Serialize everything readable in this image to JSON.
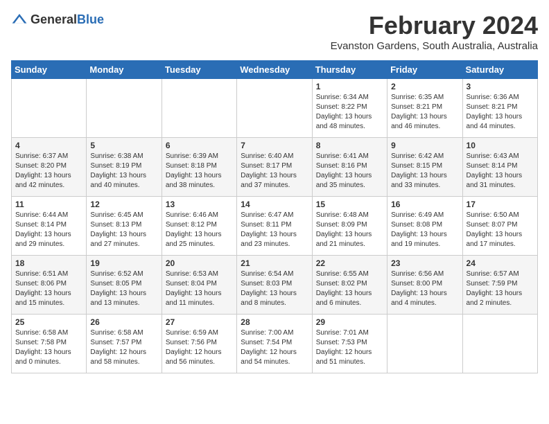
{
  "logo": {
    "text_general": "General",
    "text_blue": "Blue"
  },
  "header": {
    "month_year": "February 2024",
    "location": "Evanston Gardens, South Australia, Australia"
  },
  "days_of_week": [
    "Sunday",
    "Monday",
    "Tuesday",
    "Wednesday",
    "Thursday",
    "Friday",
    "Saturday"
  ],
  "weeks": [
    [
      {
        "day": "",
        "info": ""
      },
      {
        "day": "",
        "info": ""
      },
      {
        "day": "",
        "info": ""
      },
      {
        "day": "",
        "info": ""
      },
      {
        "day": "1",
        "info": "Sunrise: 6:34 AM\nSunset: 8:22 PM\nDaylight: 13 hours\nand 48 minutes."
      },
      {
        "day": "2",
        "info": "Sunrise: 6:35 AM\nSunset: 8:21 PM\nDaylight: 13 hours\nand 46 minutes."
      },
      {
        "day": "3",
        "info": "Sunrise: 6:36 AM\nSunset: 8:21 PM\nDaylight: 13 hours\nand 44 minutes."
      }
    ],
    [
      {
        "day": "4",
        "info": "Sunrise: 6:37 AM\nSunset: 8:20 PM\nDaylight: 13 hours\nand 42 minutes."
      },
      {
        "day": "5",
        "info": "Sunrise: 6:38 AM\nSunset: 8:19 PM\nDaylight: 13 hours\nand 40 minutes."
      },
      {
        "day": "6",
        "info": "Sunrise: 6:39 AM\nSunset: 8:18 PM\nDaylight: 13 hours\nand 38 minutes."
      },
      {
        "day": "7",
        "info": "Sunrise: 6:40 AM\nSunset: 8:17 PM\nDaylight: 13 hours\nand 37 minutes."
      },
      {
        "day": "8",
        "info": "Sunrise: 6:41 AM\nSunset: 8:16 PM\nDaylight: 13 hours\nand 35 minutes."
      },
      {
        "day": "9",
        "info": "Sunrise: 6:42 AM\nSunset: 8:15 PM\nDaylight: 13 hours\nand 33 minutes."
      },
      {
        "day": "10",
        "info": "Sunrise: 6:43 AM\nSunset: 8:14 PM\nDaylight: 13 hours\nand 31 minutes."
      }
    ],
    [
      {
        "day": "11",
        "info": "Sunrise: 6:44 AM\nSunset: 8:14 PM\nDaylight: 13 hours\nand 29 minutes."
      },
      {
        "day": "12",
        "info": "Sunrise: 6:45 AM\nSunset: 8:13 PM\nDaylight: 13 hours\nand 27 minutes."
      },
      {
        "day": "13",
        "info": "Sunrise: 6:46 AM\nSunset: 8:12 PM\nDaylight: 13 hours\nand 25 minutes."
      },
      {
        "day": "14",
        "info": "Sunrise: 6:47 AM\nSunset: 8:11 PM\nDaylight: 13 hours\nand 23 minutes."
      },
      {
        "day": "15",
        "info": "Sunrise: 6:48 AM\nSunset: 8:09 PM\nDaylight: 13 hours\nand 21 minutes."
      },
      {
        "day": "16",
        "info": "Sunrise: 6:49 AM\nSunset: 8:08 PM\nDaylight: 13 hours\nand 19 minutes."
      },
      {
        "day": "17",
        "info": "Sunrise: 6:50 AM\nSunset: 8:07 PM\nDaylight: 13 hours\nand 17 minutes."
      }
    ],
    [
      {
        "day": "18",
        "info": "Sunrise: 6:51 AM\nSunset: 8:06 PM\nDaylight: 13 hours\nand 15 minutes."
      },
      {
        "day": "19",
        "info": "Sunrise: 6:52 AM\nSunset: 8:05 PM\nDaylight: 13 hours\nand 13 minutes."
      },
      {
        "day": "20",
        "info": "Sunrise: 6:53 AM\nSunset: 8:04 PM\nDaylight: 13 hours\nand 11 minutes."
      },
      {
        "day": "21",
        "info": "Sunrise: 6:54 AM\nSunset: 8:03 PM\nDaylight: 13 hours\nand 8 minutes."
      },
      {
        "day": "22",
        "info": "Sunrise: 6:55 AM\nSunset: 8:02 PM\nDaylight: 13 hours\nand 6 minutes."
      },
      {
        "day": "23",
        "info": "Sunrise: 6:56 AM\nSunset: 8:00 PM\nDaylight: 13 hours\nand 4 minutes."
      },
      {
        "day": "24",
        "info": "Sunrise: 6:57 AM\nSunset: 7:59 PM\nDaylight: 13 hours\nand 2 minutes."
      }
    ],
    [
      {
        "day": "25",
        "info": "Sunrise: 6:58 AM\nSunset: 7:58 PM\nDaylight: 13 hours\nand 0 minutes."
      },
      {
        "day": "26",
        "info": "Sunrise: 6:58 AM\nSunset: 7:57 PM\nDaylight: 12 hours\nand 58 minutes."
      },
      {
        "day": "27",
        "info": "Sunrise: 6:59 AM\nSunset: 7:56 PM\nDaylight: 12 hours\nand 56 minutes."
      },
      {
        "day": "28",
        "info": "Sunrise: 7:00 AM\nSunset: 7:54 PM\nDaylight: 12 hours\nand 54 minutes."
      },
      {
        "day": "29",
        "info": "Sunrise: 7:01 AM\nSunset: 7:53 PM\nDaylight: 12 hours\nand 51 minutes."
      },
      {
        "day": "",
        "info": ""
      },
      {
        "day": "",
        "info": ""
      }
    ]
  ]
}
